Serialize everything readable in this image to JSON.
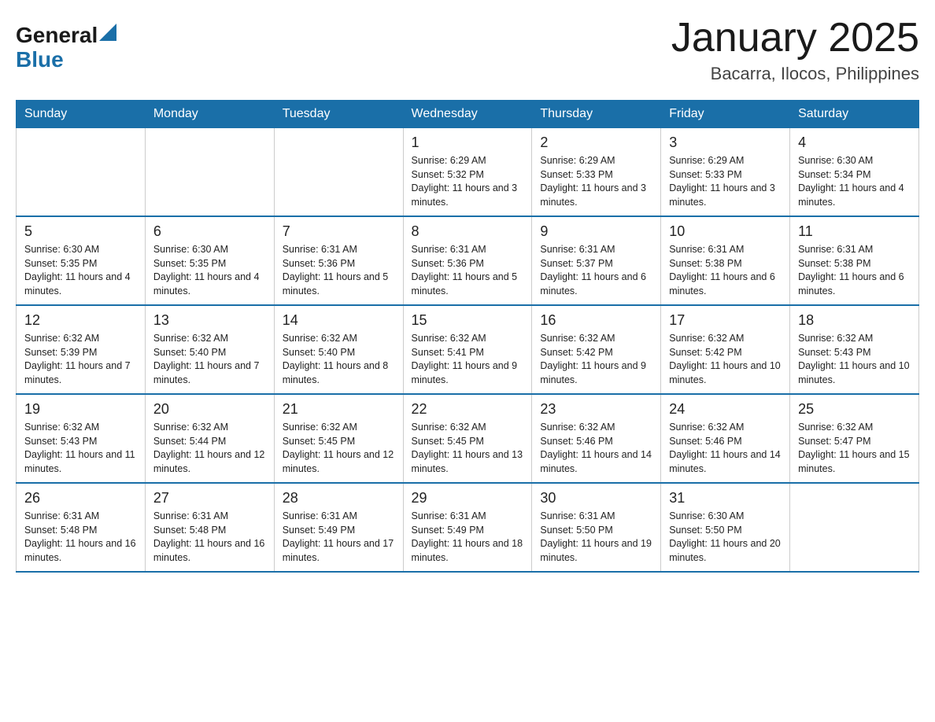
{
  "header": {
    "logo_general": "General",
    "logo_blue": "Blue",
    "title": "January 2025",
    "subtitle": "Bacarra, Ilocos, Philippines"
  },
  "days_of_week": [
    "Sunday",
    "Monday",
    "Tuesday",
    "Wednesday",
    "Thursday",
    "Friday",
    "Saturday"
  ],
  "weeks": [
    [
      {
        "day": "",
        "info": ""
      },
      {
        "day": "",
        "info": ""
      },
      {
        "day": "",
        "info": ""
      },
      {
        "day": "1",
        "info": "Sunrise: 6:29 AM\nSunset: 5:32 PM\nDaylight: 11 hours and 3 minutes."
      },
      {
        "day": "2",
        "info": "Sunrise: 6:29 AM\nSunset: 5:33 PM\nDaylight: 11 hours and 3 minutes."
      },
      {
        "day": "3",
        "info": "Sunrise: 6:29 AM\nSunset: 5:33 PM\nDaylight: 11 hours and 3 minutes."
      },
      {
        "day": "4",
        "info": "Sunrise: 6:30 AM\nSunset: 5:34 PM\nDaylight: 11 hours and 4 minutes."
      }
    ],
    [
      {
        "day": "5",
        "info": "Sunrise: 6:30 AM\nSunset: 5:35 PM\nDaylight: 11 hours and 4 minutes."
      },
      {
        "day": "6",
        "info": "Sunrise: 6:30 AM\nSunset: 5:35 PM\nDaylight: 11 hours and 4 minutes."
      },
      {
        "day": "7",
        "info": "Sunrise: 6:31 AM\nSunset: 5:36 PM\nDaylight: 11 hours and 5 minutes."
      },
      {
        "day": "8",
        "info": "Sunrise: 6:31 AM\nSunset: 5:36 PM\nDaylight: 11 hours and 5 minutes."
      },
      {
        "day": "9",
        "info": "Sunrise: 6:31 AM\nSunset: 5:37 PM\nDaylight: 11 hours and 6 minutes."
      },
      {
        "day": "10",
        "info": "Sunrise: 6:31 AM\nSunset: 5:38 PM\nDaylight: 11 hours and 6 minutes."
      },
      {
        "day": "11",
        "info": "Sunrise: 6:31 AM\nSunset: 5:38 PM\nDaylight: 11 hours and 6 minutes."
      }
    ],
    [
      {
        "day": "12",
        "info": "Sunrise: 6:32 AM\nSunset: 5:39 PM\nDaylight: 11 hours and 7 minutes."
      },
      {
        "day": "13",
        "info": "Sunrise: 6:32 AM\nSunset: 5:40 PM\nDaylight: 11 hours and 7 minutes."
      },
      {
        "day": "14",
        "info": "Sunrise: 6:32 AM\nSunset: 5:40 PM\nDaylight: 11 hours and 8 minutes."
      },
      {
        "day": "15",
        "info": "Sunrise: 6:32 AM\nSunset: 5:41 PM\nDaylight: 11 hours and 9 minutes."
      },
      {
        "day": "16",
        "info": "Sunrise: 6:32 AM\nSunset: 5:42 PM\nDaylight: 11 hours and 9 minutes."
      },
      {
        "day": "17",
        "info": "Sunrise: 6:32 AM\nSunset: 5:42 PM\nDaylight: 11 hours and 10 minutes."
      },
      {
        "day": "18",
        "info": "Sunrise: 6:32 AM\nSunset: 5:43 PM\nDaylight: 11 hours and 10 minutes."
      }
    ],
    [
      {
        "day": "19",
        "info": "Sunrise: 6:32 AM\nSunset: 5:43 PM\nDaylight: 11 hours and 11 minutes."
      },
      {
        "day": "20",
        "info": "Sunrise: 6:32 AM\nSunset: 5:44 PM\nDaylight: 11 hours and 12 minutes."
      },
      {
        "day": "21",
        "info": "Sunrise: 6:32 AM\nSunset: 5:45 PM\nDaylight: 11 hours and 12 minutes."
      },
      {
        "day": "22",
        "info": "Sunrise: 6:32 AM\nSunset: 5:45 PM\nDaylight: 11 hours and 13 minutes."
      },
      {
        "day": "23",
        "info": "Sunrise: 6:32 AM\nSunset: 5:46 PM\nDaylight: 11 hours and 14 minutes."
      },
      {
        "day": "24",
        "info": "Sunrise: 6:32 AM\nSunset: 5:46 PM\nDaylight: 11 hours and 14 minutes."
      },
      {
        "day": "25",
        "info": "Sunrise: 6:32 AM\nSunset: 5:47 PM\nDaylight: 11 hours and 15 minutes."
      }
    ],
    [
      {
        "day": "26",
        "info": "Sunrise: 6:31 AM\nSunset: 5:48 PM\nDaylight: 11 hours and 16 minutes."
      },
      {
        "day": "27",
        "info": "Sunrise: 6:31 AM\nSunset: 5:48 PM\nDaylight: 11 hours and 16 minutes."
      },
      {
        "day": "28",
        "info": "Sunrise: 6:31 AM\nSunset: 5:49 PM\nDaylight: 11 hours and 17 minutes."
      },
      {
        "day": "29",
        "info": "Sunrise: 6:31 AM\nSunset: 5:49 PM\nDaylight: 11 hours and 18 minutes."
      },
      {
        "day": "30",
        "info": "Sunrise: 6:31 AM\nSunset: 5:50 PM\nDaylight: 11 hours and 19 minutes."
      },
      {
        "day": "31",
        "info": "Sunrise: 6:30 AM\nSunset: 5:50 PM\nDaylight: 11 hours and 20 minutes."
      },
      {
        "day": "",
        "info": ""
      }
    ]
  ]
}
